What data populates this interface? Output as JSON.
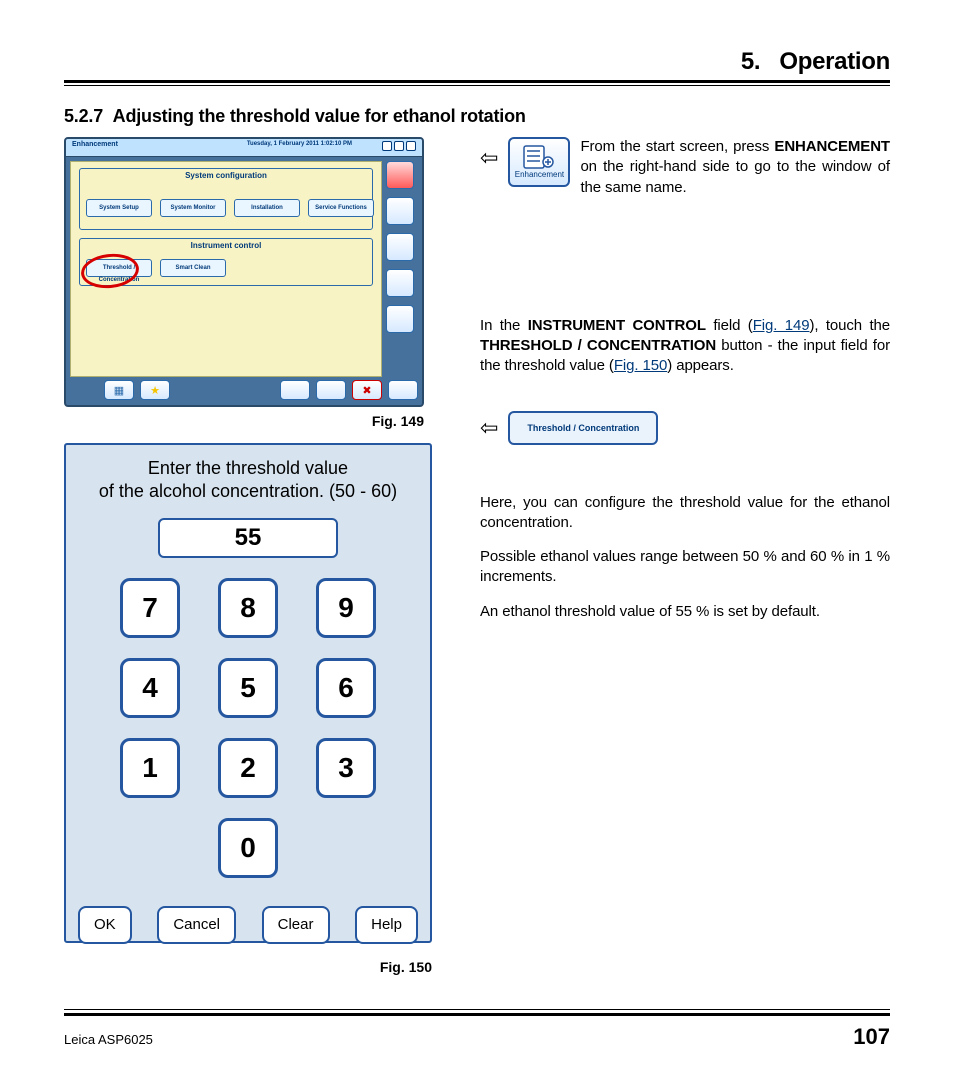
{
  "chapter": {
    "number": "5.",
    "title": "Operation"
  },
  "section": {
    "number": "5.2.7",
    "title": "Adjusting the threshold value for ethanol rotation"
  },
  "fig149": {
    "caption": "Fig. 149",
    "topbar_title": "Enhancement",
    "topbar_date": "Tuesday, 1 February 2011 1:02:10 PM",
    "panel1_title": "System configuration",
    "panel1_btns": [
      "System Setup",
      "System Monitor",
      "Installation",
      "Service Functions"
    ],
    "panel2_title": "Instrument control",
    "panel2_btns": [
      "Threshold / Concentration",
      "Smart Clean"
    ]
  },
  "fig150": {
    "caption": "Fig. 150",
    "prompt_line1": "Enter the threshold value",
    "prompt_line2": "of the alcohol concentration. (50 - 60)",
    "display_value": "55",
    "keys": {
      "k7": "7",
      "k8": "8",
      "k9": "9",
      "k4": "4",
      "k5": "5",
      "k6": "6",
      "k1": "1",
      "k2": "2",
      "k3": "3",
      "k0": "0"
    },
    "actions": {
      "ok": "OK",
      "cancel": "Cancel",
      "clear": "Clear",
      "help": "Help"
    }
  },
  "enhancement_icon": {
    "label": "Enhancement"
  },
  "threshold_btn_label": "Threshold / Concentration",
  "para1": {
    "pre": "From the start screen, press ",
    "bold": "ENHANCEMENT",
    "post": " on the right-hand side to go to the window of the same name."
  },
  "para2": {
    "t1": "In the ",
    "b1": "INSTRUMENT CONTROL",
    "t2": " field (",
    "ref1": "Fig. 149",
    "t3": "), touch the ",
    "b2": "THRESHOLD / CONCENTRATION",
    "t4": " button - the input field for the threshold value (",
    "ref2": "Fig. 150",
    "t5": ") appears."
  },
  "para3": "Here, you can configure the threshold value for the ethanol concentration.",
  "para4": "Possible ethanol values range between 50 % and 60 % in 1 % increments.",
  "para5": "An ethanol threshold value of 55 % is set by default.",
  "footer": {
    "product": "Leica ASP6025",
    "page": "107"
  }
}
